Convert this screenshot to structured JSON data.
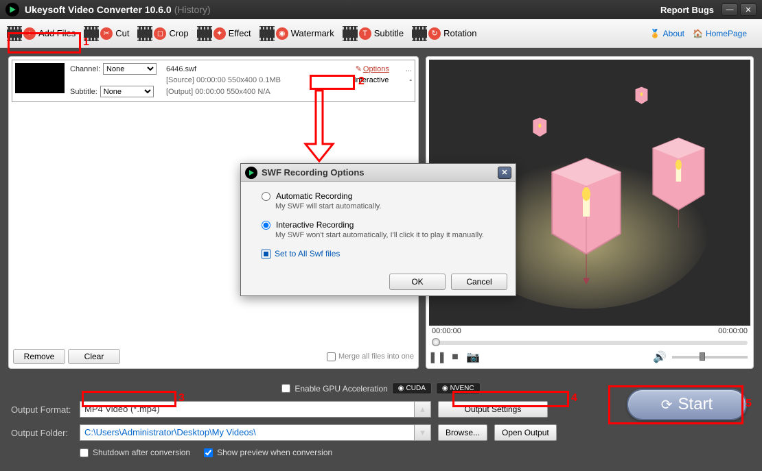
{
  "titlebar": {
    "app_name": "Ukeysoft Video Converter 10.6.0",
    "history": "(History)",
    "report_bugs": "Report Bugs"
  },
  "toolbar": {
    "add_files": "Add Files",
    "cut": "Cut",
    "crop": "Crop",
    "effect": "Effect",
    "watermark": "Watermark",
    "subtitle": "Subtitle",
    "rotation": "Rotation",
    "about": "About",
    "homepage": "HomePage"
  },
  "file": {
    "channel_label": "Channel:",
    "channel_value": "None",
    "subtitle_label": "Subtitle:",
    "subtitle_value": "None",
    "filename": "6446.swf",
    "source_line": "[Source]  00:00:00  550x400  0.1MB",
    "output_line": "[Output]  00:00:00  550x400  N/A",
    "options_link": "Options",
    "interactive_label": "Interactive",
    "interactive_value": "-"
  },
  "listbtns": {
    "remove": "Remove",
    "clear": "Clear",
    "merge": "Merge all files into one"
  },
  "preview": {
    "time_start": "00:00:00",
    "time_end": "00:00:00"
  },
  "gpu": {
    "label": "Enable GPU Acceleration",
    "cuda": "CUDA",
    "nvenc": "NVENC"
  },
  "output": {
    "format_label": "Output Format:",
    "format_value": "MP4 Video (*.mp4)",
    "settings_btn": "Output Settings",
    "folder_label": "Output Folder:",
    "folder_value": "C:\\Users\\Administrator\\Desktop\\My Videos\\",
    "browse": "Browse...",
    "open": "Open Output"
  },
  "start_btn": "Start",
  "checks": {
    "shutdown": "Shutdown after conversion",
    "preview": "Show preview when conversion"
  },
  "dialog": {
    "title": "SWF Recording Options",
    "auto_title": "Automatic Recording",
    "auto_desc": "My SWF will start automatically.",
    "inter_title": "Interactive Recording",
    "inter_desc": "My SWF won't start automatically, I'll click it to play it manually.",
    "setall": "Set to All Swf files",
    "ok": "OK",
    "cancel": "Cancel"
  },
  "annotations": {
    "n1": "1",
    "n2": "2",
    "n3": "3",
    "n4": "4",
    "n5": "5",
    "dots": "..."
  }
}
